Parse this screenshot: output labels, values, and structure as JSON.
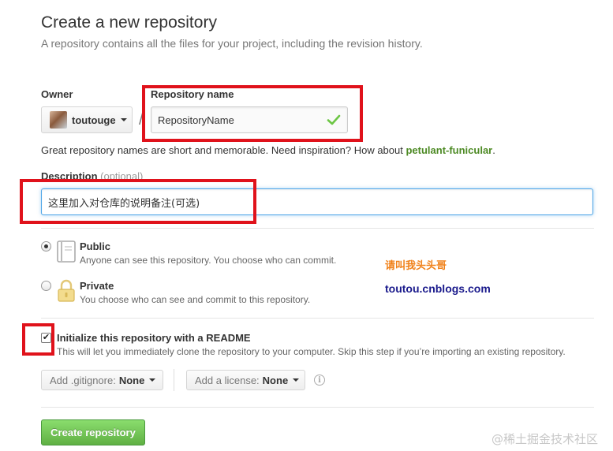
{
  "header": {
    "title": "Create a new repository",
    "subtitle": "A repository contains all the files for your project, including the revision history."
  },
  "owner": {
    "label": "Owner",
    "name": "toutouge",
    "separator": "/"
  },
  "repository": {
    "label": "Repository name",
    "value": "RepositoryName",
    "valid_icon": "check-icon"
  },
  "name_hint": {
    "text": "Great repository names are short and memorable. Need inspiration? How about ",
    "suggestion": "petulant-funicular",
    "suffix": "."
  },
  "description": {
    "label": "Description",
    "optional": "(optional)",
    "value": "这里加入对仓库的说明备注(可选)"
  },
  "visibility": {
    "options": [
      {
        "title": "Public",
        "desc": "Anyone can see this repository. You choose who can commit.",
        "selected": true,
        "icon": "book-icon"
      },
      {
        "title": "Private",
        "desc": "You choose who can see and commit to this repository.",
        "selected": false,
        "icon": "lock-icon"
      }
    ]
  },
  "readme": {
    "checked": true,
    "title": "Initialize this repository with a README",
    "desc": "This will let you immediately clone the repository to your computer. Skip this step if you’re importing an existing repository."
  },
  "gitignore": {
    "label": "Add .gitignore:",
    "value": "None"
  },
  "license": {
    "label": "Add a license:",
    "value": "None",
    "info_icon": "info-icon"
  },
  "submit": {
    "label": "Create repository"
  },
  "watermarks": {
    "author_cn": "请叫我头头哥",
    "blog_url": "toutou.cnblogs.com",
    "site": "@稀土掘金技术社区"
  },
  "colors": {
    "annotation_red": "#e0121b",
    "suggestion_green": "#4d8a24",
    "create_button_green": "#60b044",
    "focus_blue": "#51a7e8"
  }
}
